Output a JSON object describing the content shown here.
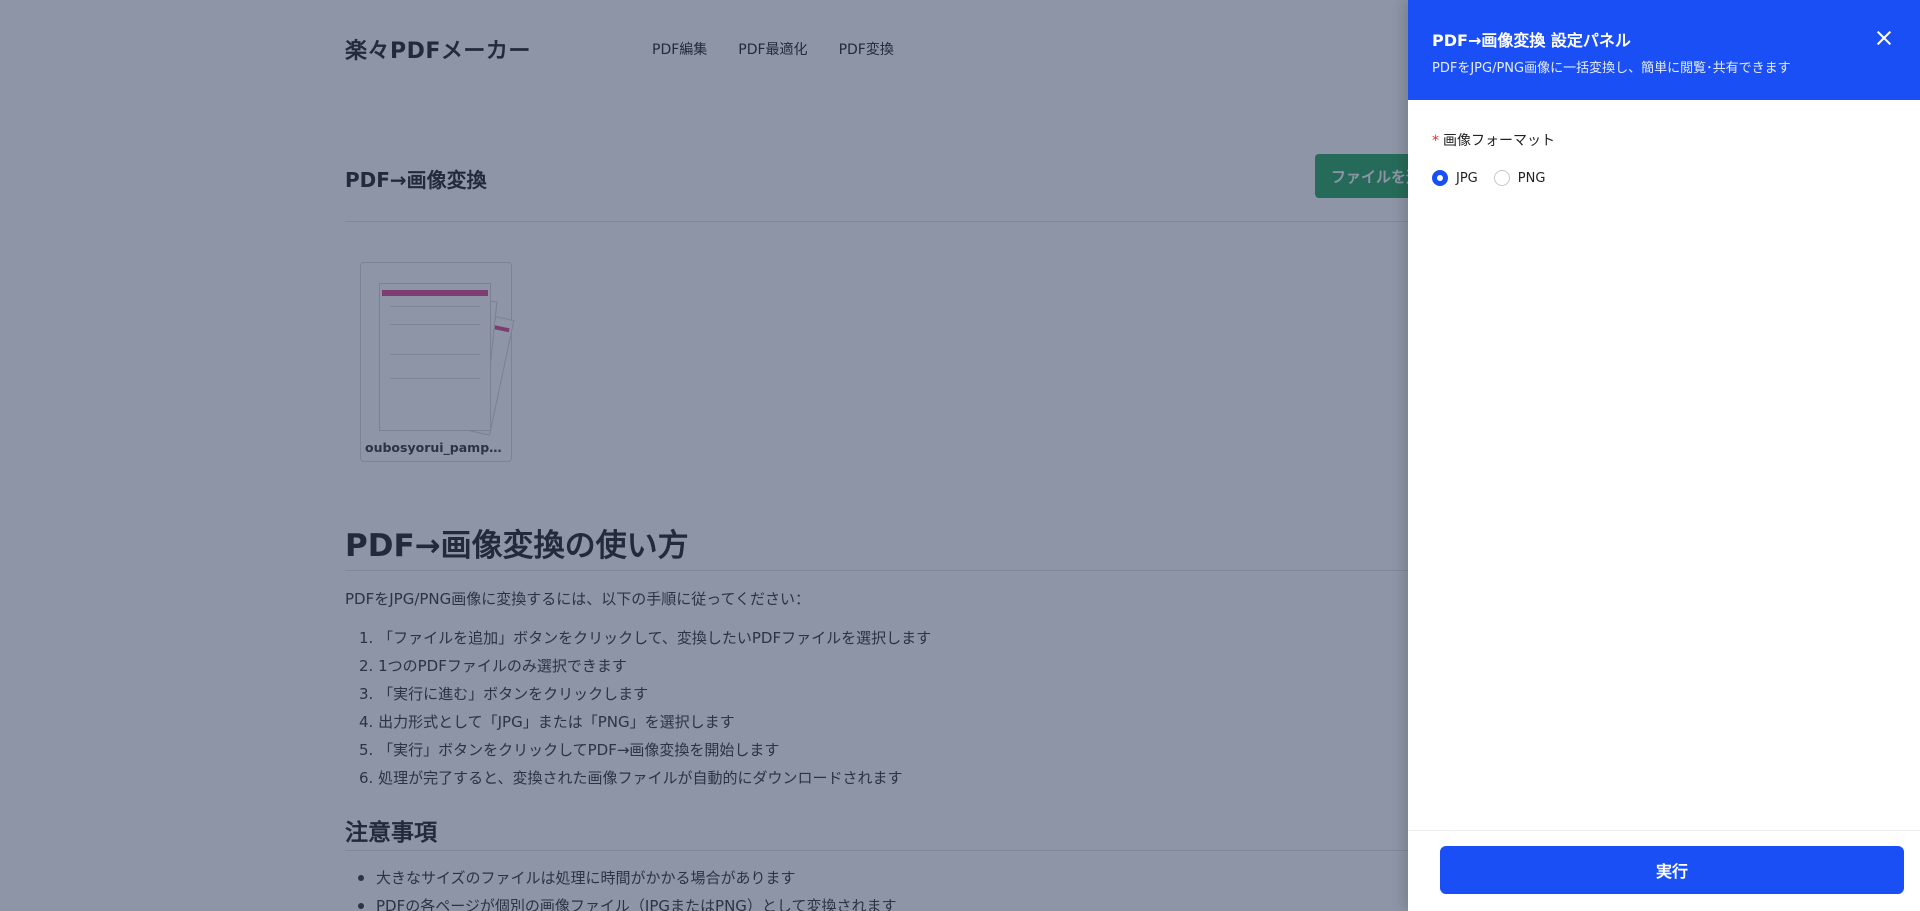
{
  "header": {
    "logo": "楽々PDFメーカー",
    "nav": [
      "PDF編集",
      "PDF最適化",
      "PDF変換"
    ]
  },
  "main": {
    "section_title": "PDF→画像変換",
    "add_button_label": "ファイルを追加",
    "file": {
      "name": "oubosyorui_pamphl..."
    },
    "howto": {
      "title": "PDF→画像変換の使い方",
      "intro": "PDFをJPG/PNG画像に変換するには、以下の手順に従ってください：",
      "steps": [
        "1. 「ファイルを追加」ボタンをクリックして、変換したいPDFファイルを選択します",
        "2. 1つのPDFファイルのみ選択できます",
        "3. 「実行に進む」ボタンをクリックします",
        "4. 出力形式として「JPG」または「PNG」を選択します",
        "5. 「実行」ボタンをクリックしてPDF→画像変換を開始します",
        "6. 処理が完了すると、変換された画像ファイルが自動的にダウンロードされます"
      ]
    },
    "notes": {
      "title": "注意事項",
      "items": [
        "大きなサイズのファイルは処理に時間がかかる場合があります",
        "PDFの各ページが個別の画像ファイル（JPGまたはPNG）として変換されます"
      ]
    }
  },
  "drawer": {
    "title": "PDF→画像変換 設定パネル",
    "subtitle": "PDFをJPG/PNG画像に一括変換し、簡単に閲覧･共有できます",
    "field_label": "画像フォーマット",
    "required_mark": "*",
    "options": [
      {
        "label": "JPG",
        "checked": true
      },
      {
        "label": "PNG",
        "checked": false
      }
    ],
    "run_label": "実行"
  },
  "colors": {
    "accent": "#1a4ff5",
    "add_button": "#3aaf6b",
    "pdf_band": "#e2579b",
    "required": "#f5222d"
  },
  "icons": [
    "close-icon"
  ]
}
